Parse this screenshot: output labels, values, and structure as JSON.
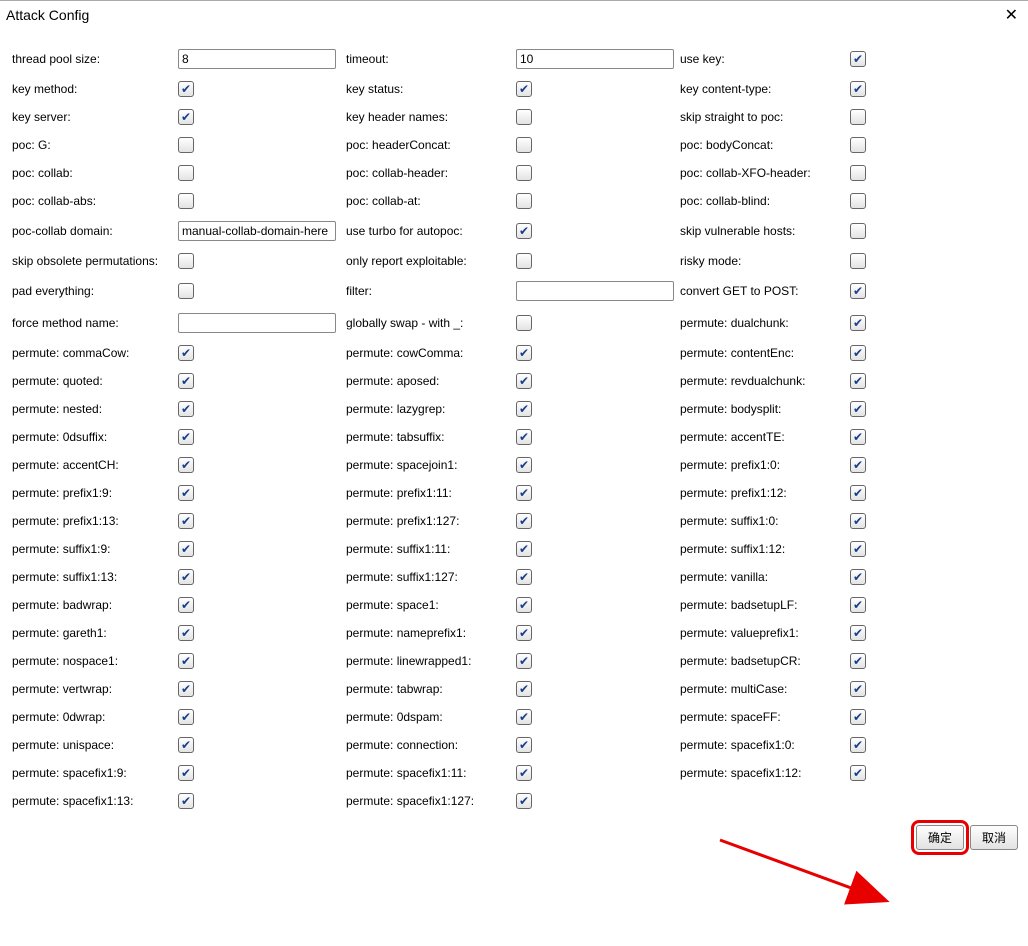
{
  "title": "Attack Config",
  "buttons": {
    "ok": "确定",
    "cancel": "取消"
  },
  "rows": [
    [
      {
        "label": "thread pool size:",
        "control": "text",
        "value": "8",
        "name": "thread-pool-size"
      },
      {
        "label": "timeout:",
        "control": "text",
        "value": "10",
        "name": "timeout"
      },
      {
        "label": "use key:",
        "control": "check",
        "checked": true,
        "name": "use-key"
      }
    ],
    [
      {
        "label": "key method:",
        "control": "check",
        "checked": true,
        "name": "key-method"
      },
      {
        "label": "key status:",
        "control": "check",
        "checked": true,
        "name": "key-status"
      },
      {
        "label": "key content-type:",
        "control": "check",
        "checked": true,
        "name": "key-content-type"
      }
    ],
    [
      {
        "label": "key server:",
        "control": "check",
        "checked": true,
        "name": "key-server"
      },
      {
        "label": "key header names:",
        "control": "check",
        "checked": false,
        "name": "key-header-names"
      },
      {
        "label": "skip straight to poc:",
        "control": "check",
        "checked": false,
        "name": "skip-straight-to-poc"
      }
    ],
    [
      {
        "label": "poc: G:",
        "control": "check",
        "checked": false,
        "name": "poc-g"
      },
      {
        "label": "poc: headerConcat:",
        "control": "check",
        "checked": false,
        "name": "poc-headerconcat"
      },
      {
        "label": "poc: bodyConcat:",
        "control": "check",
        "checked": false,
        "name": "poc-bodyconcat"
      }
    ],
    [
      {
        "label": "poc: collab:",
        "control": "check",
        "checked": false,
        "name": "poc-collab"
      },
      {
        "label": "poc: collab-header:",
        "control": "check",
        "checked": false,
        "name": "poc-collab-header"
      },
      {
        "label": "poc: collab-XFO-header:",
        "control": "check",
        "checked": false,
        "name": "poc-collab-xfo-header"
      }
    ],
    [
      {
        "label": "poc: collab-abs:",
        "control": "check",
        "checked": false,
        "name": "poc-collab-abs"
      },
      {
        "label": "poc: collab-at:",
        "control": "check",
        "checked": false,
        "name": "poc-collab-at"
      },
      {
        "label": "poc: collab-blind:",
        "control": "check",
        "checked": false,
        "name": "poc-collab-blind"
      }
    ],
    [
      {
        "label": "poc-collab domain:",
        "control": "text",
        "value": "manual-collab-domain-here",
        "name": "poc-collab-domain"
      },
      {
        "label": "use turbo for autopoc:",
        "control": "check",
        "checked": true,
        "name": "use-turbo-autopoc"
      },
      {
        "label": "skip vulnerable hosts:",
        "control": "check",
        "checked": false,
        "name": "skip-vulnerable-hosts"
      }
    ],
    [
      {
        "label": "skip obsolete permutations:",
        "control": "check",
        "checked": false,
        "name": "skip-obsolete-permutations"
      },
      {
        "label": "only report exploitable:",
        "control": "check",
        "checked": false,
        "name": "only-report-exploitable"
      },
      {
        "label": "risky mode:",
        "control": "check",
        "checked": false,
        "name": "risky-mode"
      }
    ],
    [
      {
        "label": "pad everything:",
        "control": "check",
        "checked": false,
        "name": "pad-everything"
      },
      {
        "label": "filter:",
        "control": "text",
        "value": "",
        "name": "filter"
      },
      {
        "label": "convert GET to POST:",
        "control": "check",
        "checked": true,
        "name": "convert-get-to-post"
      }
    ],
    [
      {
        "label": "force method name:",
        "control": "text",
        "value": "",
        "name": "force-method-name"
      },
      {
        "label": "globally swap - with _:",
        "control": "check",
        "checked": false,
        "name": "globally-swap-dash-underscore"
      },
      {
        "label": "permute: dualchunk:",
        "control": "check",
        "checked": true,
        "name": "permute-dualchunk"
      }
    ],
    [
      {
        "label": "permute: commaCow:",
        "control": "check",
        "checked": true,
        "name": "permute-commacow"
      },
      {
        "label": "permute: cowComma:",
        "control": "check",
        "checked": true,
        "name": "permute-cowcomma"
      },
      {
        "label": "permute: contentEnc:",
        "control": "check",
        "checked": true,
        "name": "permute-contentenc"
      }
    ],
    [
      {
        "label": "permute: quoted:",
        "control": "check",
        "checked": true,
        "name": "permute-quoted"
      },
      {
        "label": "permute: aposed:",
        "control": "check",
        "checked": true,
        "name": "permute-aposed"
      },
      {
        "label": "permute: revdualchunk:",
        "control": "check",
        "checked": true,
        "name": "permute-revdualchunk"
      }
    ],
    [
      {
        "label": "permute: nested:",
        "control": "check",
        "checked": true,
        "name": "permute-nested"
      },
      {
        "label": "permute: lazygrep:",
        "control": "check",
        "checked": true,
        "name": "permute-lazygrep"
      },
      {
        "label": "permute: bodysplit:",
        "control": "check",
        "checked": true,
        "name": "permute-bodysplit"
      }
    ],
    [
      {
        "label": "permute: 0dsuffix:",
        "control": "check",
        "checked": true,
        "name": "permute-0dsuffix"
      },
      {
        "label": "permute: tabsuffix:",
        "control": "check",
        "checked": true,
        "name": "permute-tabsuffix"
      },
      {
        "label": "permute: accentTE:",
        "control": "check",
        "checked": true,
        "name": "permute-accentte"
      }
    ],
    [
      {
        "label": "permute: accentCH:",
        "control": "check",
        "checked": true,
        "name": "permute-accentch"
      },
      {
        "label": "permute: spacejoin1:",
        "control": "check",
        "checked": true,
        "name": "permute-spacejoin1"
      },
      {
        "label": "permute: prefix1:0:",
        "control": "check",
        "checked": true,
        "name": "permute-prefix1-0"
      }
    ],
    [
      {
        "label": "permute: prefix1:9:",
        "control": "check",
        "checked": true,
        "name": "permute-prefix1-9"
      },
      {
        "label": "permute: prefix1:11:",
        "control": "check",
        "checked": true,
        "name": "permute-prefix1-11"
      },
      {
        "label": "permute: prefix1:12:",
        "control": "check",
        "checked": true,
        "name": "permute-prefix1-12"
      }
    ],
    [
      {
        "label": "permute: prefix1:13:",
        "control": "check",
        "checked": true,
        "name": "permute-prefix1-13"
      },
      {
        "label": "permute: prefix1:127:",
        "control": "check",
        "checked": true,
        "name": "permute-prefix1-127"
      },
      {
        "label": "permute: suffix1:0:",
        "control": "check",
        "checked": true,
        "name": "permute-suffix1-0"
      }
    ],
    [
      {
        "label": "permute: suffix1:9:",
        "control": "check",
        "checked": true,
        "name": "permute-suffix1-9"
      },
      {
        "label": "permute: suffix1:11:",
        "control": "check",
        "checked": true,
        "name": "permute-suffix1-11"
      },
      {
        "label": "permute: suffix1:12:",
        "control": "check",
        "checked": true,
        "name": "permute-suffix1-12"
      }
    ],
    [
      {
        "label": "permute: suffix1:13:",
        "control": "check",
        "checked": true,
        "name": "permute-suffix1-13"
      },
      {
        "label": "permute: suffix1:127:",
        "control": "check",
        "checked": true,
        "name": "permute-suffix1-127"
      },
      {
        "label": "permute: vanilla:",
        "control": "check",
        "checked": true,
        "name": "permute-vanilla"
      }
    ],
    [
      {
        "label": "permute: badwrap:",
        "control": "check",
        "checked": true,
        "name": "permute-badwrap"
      },
      {
        "label": "permute: space1:",
        "control": "check",
        "checked": true,
        "name": "permute-space1"
      },
      {
        "label": "permute: badsetupLF:",
        "control": "check",
        "checked": true,
        "name": "permute-badsetuplf"
      }
    ],
    [
      {
        "label": "permute: gareth1:",
        "control": "check",
        "checked": true,
        "name": "permute-gareth1"
      },
      {
        "label": "permute: nameprefix1:",
        "control": "check",
        "checked": true,
        "name": "permute-nameprefix1"
      },
      {
        "label": "permute: valueprefix1:",
        "control": "check",
        "checked": true,
        "name": "permute-valueprefix1"
      }
    ],
    [
      {
        "label": "permute: nospace1:",
        "control": "check",
        "checked": true,
        "name": "permute-nospace1"
      },
      {
        "label": "permute: linewrapped1:",
        "control": "check",
        "checked": true,
        "name": "permute-linewrapped1"
      },
      {
        "label": "permute: badsetupCR:",
        "control": "check",
        "checked": true,
        "name": "permute-badsetupcr"
      }
    ],
    [
      {
        "label": "permute: vertwrap:",
        "control": "check",
        "checked": true,
        "name": "permute-vertwrap"
      },
      {
        "label": "permute: tabwrap:",
        "control": "check",
        "checked": true,
        "name": "permute-tabwrap"
      },
      {
        "label": "permute: multiCase:",
        "control": "check",
        "checked": true,
        "name": "permute-multicase"
      }
    ],
    [
      {
        "label": "permute: 0dwrap:",
        "control": "check",
        "checked": true,
        "name": "permute-0dwrap"
      },
      {
        "label": "permute: 0dspam:",
        "control": "check",
        "checked": true,
        "name": "permute-0dspam"
      },
      {
        "label": "permute: spaceFF:",
        "control": "check",
        "checked": true,
        "name": "permute-spaceff"
      }
    ],
    [
      {
        "label": "permute: unispace:",
        "control": "check",
        "checked": true,
        "name": "permute-unispace"
      },
      {
        "label": "permute: connection:",
        "control": "check",
        "checked": true,
        "name": "permute-connection"
      },
      {
        "label": "permute: spacefix1:0:",
        "control": "check",
        "checked": true,
        "name": "permute-spacefix1-0"
      }
    ],
    [
      {
        "label": "permute: spacefix1:9:",
        "control": "check",
        "checked": true,
        "name": "permute-spacefix1-9"
      },
      {
        "label": "permute: spacefix1:11:",
        "control": "check",
        "checked": true,
        "name": "permute-spacefix1-11"
      },
      {
        "label": "permute: spacefix1:12:",
        "control": "check",
        "checked": true,
        "name": "permute-spacefix1-12"
      }
    ],
    [
      {
        "label": "permute: spacefix1:13:",
        "control": "check",
        "checked": true,
        "name": "permute-spacefix1-13"
      },
      {
        "label": "permute: spacefix1:127:",
        "control": "check",
        "checked": true,
        "name": "permute-spacefix1-127"
      },
      {
        "label": "",
        "control": "none",
        "name": "empty"
      }
    ]
  ]
}
